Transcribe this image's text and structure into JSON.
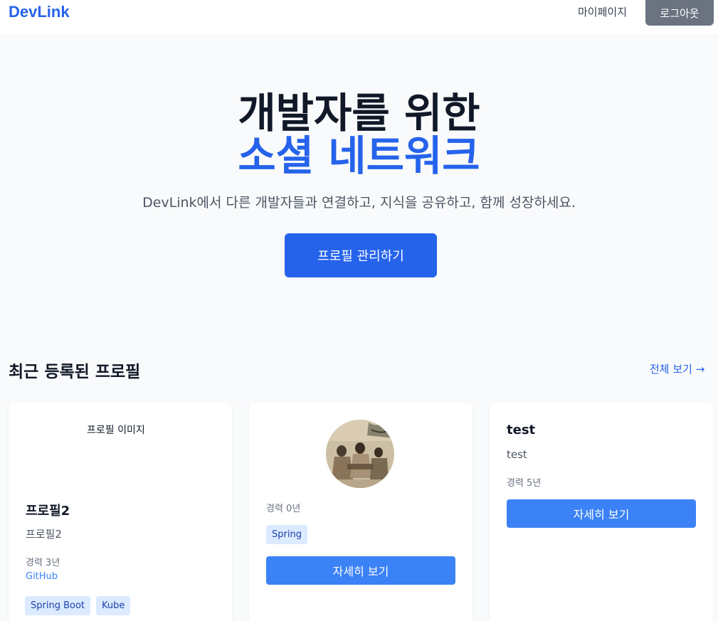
{
  "nav": {
    "logo": "DevLink",
    "mypage": "마이페이지",
    "logout": "로그아웃"
  },
  "hero": {
    "title_line1": "개발자를 위한",
    "title_line2": "소셜 네트워크",
    "subtitle": "DevLink에서 다른 개발자들과 연결하고, 지식을 공유하고, 함께 성장하세요.",
    "cta": "프로필 관리하기"
  },
  "recent": {
    "title": "최근 등록된 프로필",
    "view_all": "전체 보기 →"
  },
  "cards": [
    {
      "image_alt": "프로필 이미지",
      "name": "프로필2",
      "description": "프로필2",
      "experience": "경력 3년",
      "link": "GitHub",
      "tags": [
        "Spring Boot",
        "Kube"
      ]
    },
    {
      "experience": "경력 0년",
      "tags": [
        "Spring"
      ],
      "button": "자세히 보기"
    },
    {
      "name": "test",
      "description": "test",
      "experience": "경력 5년",
      "button": "자세히 보기"
    }
  ],
  "colors": {
    "brand": "#2563eb",
    "button": "#3b82f6",
    "logout": "#6b7280",
    "tag_bg": "#dbeafe"
  }
}
